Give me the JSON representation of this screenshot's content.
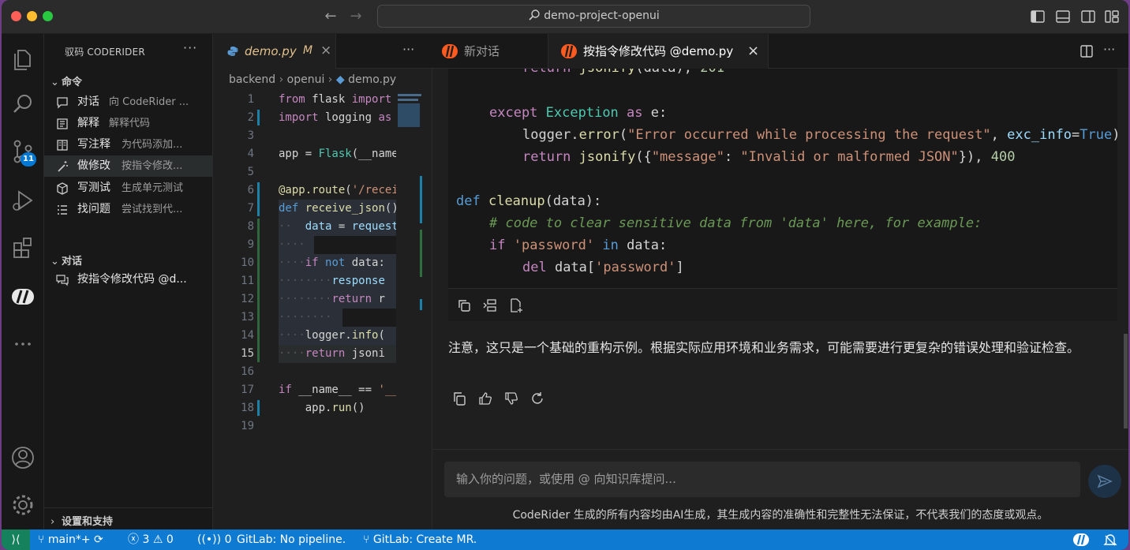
{
  "window": {
    "title": "demo-project-openui",
    "colors": {
      "close": "#ff5f57",
      "minimize": "#febc2e",
      "zoom": "#28c840",
      "accent": "#0e7ad1",
      "brand": "#ff5a1f"
    }
  },
  "activity_bar": {
    "scm_badge": "11",
    "items": [
      "explorer-icon",
      "search-icon",
      "source-control-icon",
      "run-debug-icon",
      "extensions-icon",
      "coderider-icon",
      "more-icon",
      "account-icon",
      "settings-gear-icon"
    ]
  },
  "sidebar": {
    "title": "驭码 CODERIDER",
    "more": "···",
    "commands_section": "命令",
    "commands": [
      {
        "label": "对话",
        "desc": "向 CodeRider ...",
        "icon": "comment-icon"
      },
      {
        "label": "解释",
        "desc": "解释代码",
        "icon": "book-icon"
      },
      {
        "label": "写注释",
        "desc": "为代码添加...",
        "icon": "notebook-icon"
      },
      {
        "label": "做修改",
        "desc": "按指令修改...",
        "icon": "magic-wand-icon"
      },
      {
        "label": "写测试",
        "desc": "生成单元测试",
        "icon": "package-icon"
      },
      {
        "label": "找问题",
        "desc": "尝试找到代...",
        "icon": "checklist-icon"
      }
    ],
    "chats_section": "对话",
    "chats": [
      {
        "label": "按指令修改代码 @d...",
        "icon": "chat-bubbles-icon"
      }
    ],
    "footer_section": "设置和支持"
  },
  "editor": {
    "tab": {
      "filename": "demo.py",
      "status": "M",
      "close": "×"
    },
    "more": "···",
    "breadcrumb": [
      "backend",
      "openui",
      "demo.py"
    ],
    "current_line": 15
  },
  "chat": {
    "tabs": [
      {
        "label": "新对话",
        "active": false
      },
      {
        "label": "按指令修改代码 @demo.py",
        "active": true,
        "close": "×"
      }
    ],
    "note": "注意，这只是一个基础的重构示例。根据实际应用环境和业务需求，可能需要进行更复杂的错误处理和验证检查。",
    "input_placeholder": "输入你的问题，或使用 @ 向知识库提问...",
    "disclaimer": "CodeRider 生成的所有内容均由AI生成，其生成内容的准确性和完整性无法保证，不代表我们的态度或观点。"
  },
  "statusbar": {
    "branch": "main*+",
    "errors": "3",
    "warnings": "0",
    "ports": "0",
    "pipeline": "GitLab: No pipeline.",
    "mr": "GitLab: Create MR."
  }
}
